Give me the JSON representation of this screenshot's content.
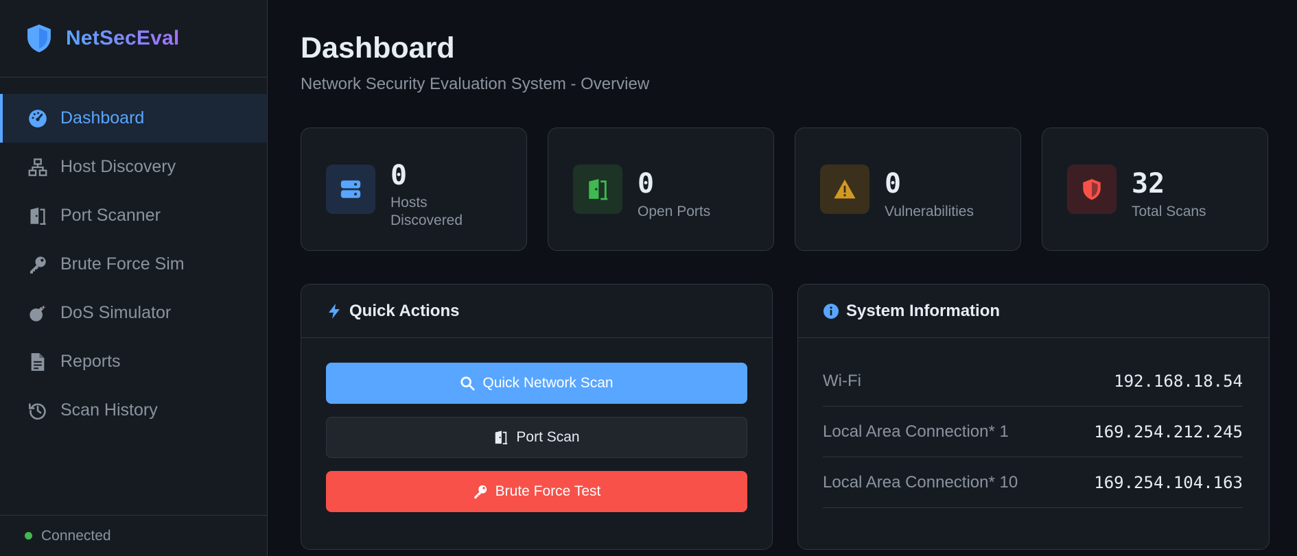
{
  "brand": {
    "name": "NetSecEval",
    "icon": "shield-icon"
  },
  "nav": [
    {
      "label": "Dashboard",
      "icon": "gauge-icon",
      "active": true
    },
    {
      "label": "Host Discovery",
      "icon": "network-icon",
      "active": false
    },
    {
      "label": "Port Scanner",
      "icon": "door-icon",
      "active": false
    },
    {
      "label": "Brute Force Sim",
      "icon": "key-icon",
      "active": false
    },
    {
      "label": "DoS Simulator",
      "icon": "bomb-icon",
      "active": false
    },
    {
      "label": "Reports",
      "icon": "document-icon",
      "active": false
    },
    {
      "label": "Scan History",
      "icon": "history-icon",
      "active": false
    }
  ],
  "status": {
    "label": "Connected",
    "color": "#3fb950"
  },
  "header": {
    "title": "Dashboard",
    "subtitle": "Network Security Evaluation System - Overview"
  },
  "stats": [
    {
      "value": "0",
      "label_line1": "Hosts",
      "label_line2": "Discovered",
      "icon": "server-icon",
      "color": "#58a6ff"
    },
    {
      "value": "0",
      "label_line1": "Open Ports",
      "label_line2": "",
      "icon": "door-open-icon",
      "color": "#3fb950"
    },
    {
      "value": "0",
      "label_line1": "Vulnerabilities",
      "label_line2": "",
      "icon": "warning-icon",
      "color": "#d29922"
    },
    {
      "value": "32",
      "label_line1": "Total Scans",
      "label_line2": "",
      "icon": "shield-alert-icon",
      "color": "#f85149"
    }
  ],
  "quick_actions": {
    "title": "Quick Actions",
    "buttons": [
      {
        "label": "Quick Network Scan",
        "icon": "search-icon",
        "variant": "primary"
      },
      {
        "label": "Port Scan",
        "icon": "door-icon",
        "variant": "secondary"
      },
      {
        "label": "Brute Force Test",
        "icon": "key-icon",
        "variant": "danger"
      }
    ]
  },
  "system_info": {
    "title": "System Information",
    "rows": [
      {
        "label": "Wi-Fi",
        "value": "192.168.18.54"
      },
      {
        "label": "Local Area Connection* 1",
        "value": "169.254.212.245"
      },
      {
        "label": "Local Area Connection* 10",
        "value": "169.254.104.163"
      }
    ]
  }
}
